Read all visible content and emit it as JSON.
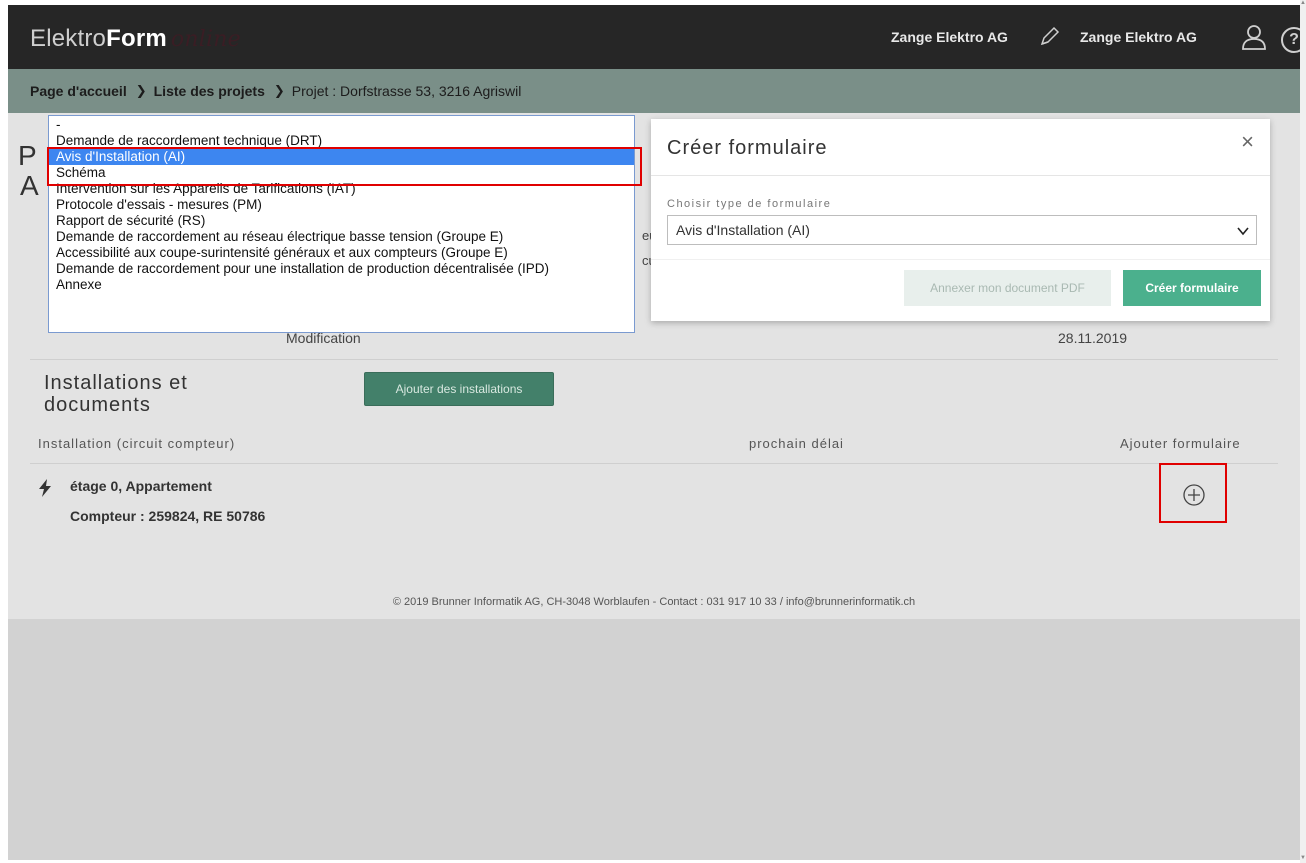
{
  "header": {
    "logo_regular": "Elektro",
    "logo_bold": "Form",
    "logo_script": "online",
    "company_left": "Zange Elektro AG",
    "company_right": "Zange Elektro AG"
  },
  "breadcrumb": {
    "home": "Page d'accueil",
    "projects": "Liste des projets",
    "project_label": "Projet :",
    "project_address": "Dorfstrasse 53, 3216 Agriswil"
  },
  "page": {
    "title_initial_1": "P",
    "title_initial_2": "A",
    "frag1": "eu",
    "frag2": "cul",
    "modification_label": "Modification",
    "modification_date": "28.11.2019"
  },
  "installations": {
    "title": "Installations et documents",
    "add_button": "Ajouter des installations",
    "columns": [
      "Installation (circuit compteur)",
      "prochain délai",
      "Ajouter formulaire"
    ],
    "rows": [
      {
        "line1": "étage 0, Appartement",
        "line2": "Compteur : 259824, RE 50786"
      }
    ]
  },
  "footer": "© 2019 Brunner Informatik AG, CH-3048 Worblaufen - Contact : 031 917 10 33 / info@brunnerinformatik.ch",
  "modal": {
    "title": "Créer formulaire",
    "close": "×",
    "field_label": "Choisir type de formulaire",
    "selected_value": "Avis d'Installation (AI)",
    "btn_pdf": "Annexer mon document PDF",
    "btn_create": "Créer formulaire"
  },
  "dropdown": {
    "options": [
      "-",
      "Demande de raccordement technique (DRT)",
      "Avis d'Installation (AI)",
      "Schéma",
      "Intervention sur les Appareils de Tarifications (IAT)",
      "Protocole d'essais - mesures (PM)",
      "Rapport de sécurité (RS)",
      "Demande de raccordement au réseau électrique basse tension (Groupe E)",
      "Accessibilité aux coupe-surintensité généraux et aux compteurs (Groupe E)",
      "Demande de raccordement pour une installation de production décentralisée (IPD)",
      "Annexe"
    ],
    "selected_index": 2
  },
  "colors": {
    "header_bg": "#262626",
    "breadcrumb_bg": "#7a8f88",
    "accent_green": "#4bb08d",
    "selection_blue": "#3d86f0",
    "highlight_red": "#e00000"
  }
}
